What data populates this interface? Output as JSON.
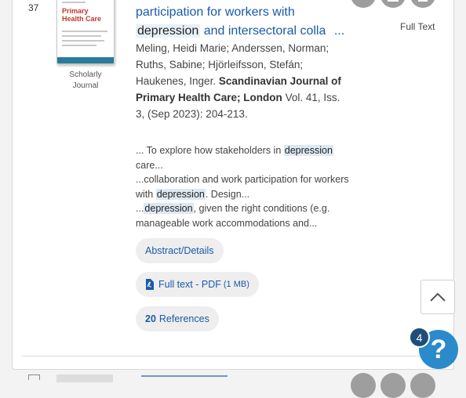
{
  "result": {
    "number": "37",
    "thumbnail": {
      "cover_title": "Primary Health Care"
    },
    "doc_type": "Scholarly Journal",
    "title": {
      "part1": "participation for workers with",
      "highlight": "depression",
      "part2": " and intersectoral colla",
      "ellipsis": "..."
    },
    "authors": "Meling, Heidi Marie; Anderssen, Norman; Ruths, Sabine; Hjörleifsson, Stefán; Haukenes, Inger.",
    "journal": "Scandinavian Journal of Primary Health Care; London",
    "citation": "Vol. 41, Iss. 3,  (Sep 2023): 204-213.",
    "snippet": {
      "s1_pre": "... To explore how stakeholders in ",
      "s1_hl": "depression",
      "s1_post": " care...",
      "s2_pre": "...collaboration and work participation for workers with ",
      "s2_hl": "depression",
      "s2_post": ". Design...",
      "s3_pre": "...",
      "s3_hl": "depression",
      "s3_post": ", given the right conditions (e.g. manageable work accommodations and..."
    },
    "links": {
      "abstract": "Abstract/Details",
      "fulltext_pdf": "Full text - PDF",
      "pdf_size": "(1 MB)",
      "ref_count": "20",
      "references": "References"
    },
    "full_text_label": "Full Text",
    "icons": [
      "cite-icon",
      "email-icon",
      "save-icon"
    ]
  },
  "floating": {
    "help_badge": "4",
    "help_glyph": "?"
  }
}
